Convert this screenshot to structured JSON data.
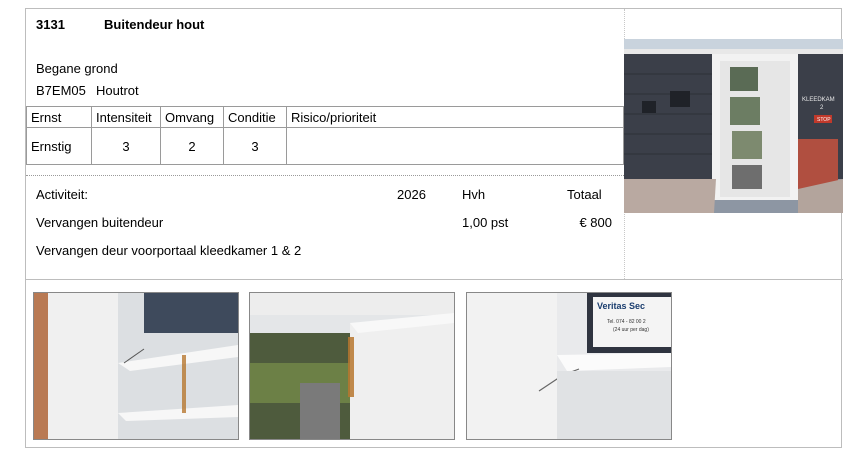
{
  "item": {
    "code": "3131",
    "title": "Buitendeur hout",
    "floor": "Begane grond",
    "element_code": "B7EM05",
    "defect": "Houtrot"
  },
  "condition_table": {
    "headers": [
      "Ernst",
      "Intensiteit",
      "Omvang",
      "Conditie",
      "Risico/prioriteit"
    ],
    "values": [
      "Ernstig",
      "3",
      "2",
      "3",
      ""
    ]
  },
  "activity": {
    "label": "Activiteit:",
    "year": "2026",
    "qty_label": "Hvh",
    "total_label": "Totaal",
    "rows": [
      {
        "description": "Vervangen buitendeur",
        "quantity": "1,00 pst",
        "amount": "€ 800"
      },
      {
        "description": "Vervangen deur voorportaal kleedkamer 1 & 2"
      }
    ]
  },
  "photo_sign": {
    "line1": "KLEEDKAM",
    "line2": "2",
    "small": "STOP"
  },
  "thumb3_sticker": {
    "brand": "Veritas Sec",
    "tel": "Tel. 074 - 82 00 2",
    "note": "(24 uur per dag)"
  }
}
